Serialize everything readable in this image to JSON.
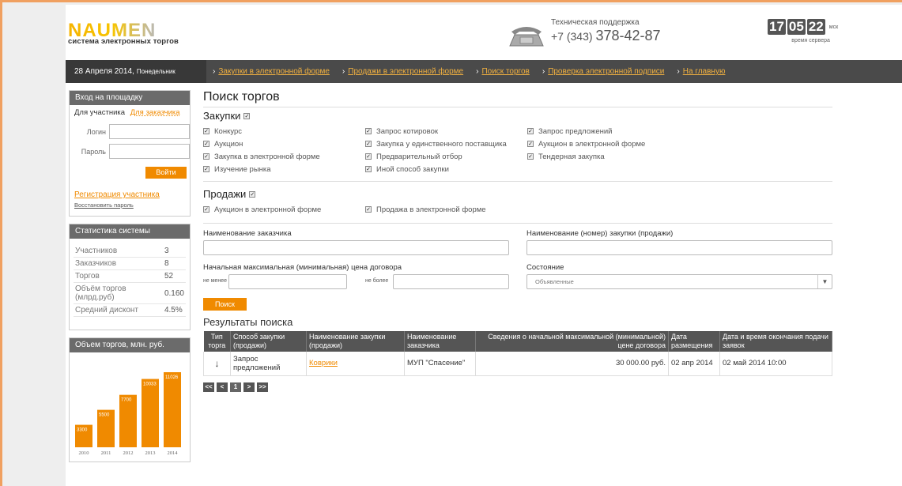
{
  "header": {
    "logo_text": "NAUMEN",
    "logo_subtitle": "система электронных торгов",
    "support_label": "Техническая поддержка",
    "support_phone_prefix": "+7 (343)",
    "support_phone_number": "378-42-87",
    "clock_hours": "17",
    "clock_minutes": "05",
    "clock_seconds": "22",
    "clock_tz": "мск",
    "clock_label": "время сервера",
    "phone_icon": "telephone-icon"
  },
  "nav": {
    "date": "28 Апреля 2014,",
    "weekday": "Понедельник",
    "links": [
      "Закупки в электронной форме",
      "Продажи в электронной форме",
      "Поиск торгов",
      "Проверка электронной подписи",
      "На главную"
    ]
  },
  "login": {
    "title": "Вход на площадку",
    "tab_active": "Для участника",
    "tab_other": "Для заказчика",
    "login_label": "Логин",
    "password_label": "Пароль",
    "login_value": "",
    "password_value": "",
    "submit": "Войти",
    "register_link": "Регистрация участника",
    "restore_link": "Восстановить пароль"
  },
  "stats": {
    "title": "Статистика системы",
    "rows": [
      {
        "label": "Участников",
        "value": "3"
      },
      {
        "label": "Заказчиков",
        "value": "8"
      },
      {
        "label": "Торгов",
        "value": "52"
      },
      {
        "label": "Объём торгов (млрд.руб)",
        "value": "0.160"
      },
      {
        "label": "Средний дисконт",
        "value": "4.5%"
      }
    ]
  },
  "volume": {
    "title": "Объем торгов, млн. руб."
  },
  "chart_data": {
    "type": "bar",
    "title": "Объем торгов, млн. руб.",
    "categories": [
      "2010",
      "2011",
      "2012",
      "2013",
      "2014"
    ],
    "values": [
      3300,
      5500,
      7700,
      10033,
      11026
    ],
    "color": "#f08a00"
  },
  "main": {
    "title": "Поиск торгов",
    "purchases_heading": "Закупки",
    "purchases": [
      "Конкурс",
      "Запрос котировок",
      "Запрос предложений",
      "Аукцион",
      "Закупка у единственного поставщика",
      "Аукцион в электронной форме",
      "Закупка в электронной форме",
      "Предварительный отбор",
      "Тендерная закупка",
      "Изучение рынка",
      "Иной способ закупки"
    ],
    "sales_heading": "Продажи",
    "sales": [
      "Аукцион в электронной форме",
      "Продажа в электронной форме"
    ],
    "customer_name_label": "Наименование заказчика",
    "customer_name_value": "",
    "purchase_name_label": "Наименование (номер) закупки (продажи)",
    "purchase_name_value": "",
    "price_label": "Начальная максимальная (минимальная) цена договора",
    "price_min_label": "не менее",
    "price_min_value": "",
    "price_max_label": "не более",
    "price_max_value": "",
    "state_label": "Состояние",
    "state_value": "Объявленные",
    "search_button": "Поиск",
    "results_title": "Результаты поиска",
    "columns": [
      "Тип торга",
      "Способ закупки (продажи)",
      "Наименование закупки (продажи)",
      "Наименование заказчика",
      "Сведения о начальной максимальной (минимальной) цене договора",
      "Дата размещения",
      "Дата и время окончания подачи заявок"
    ],
    "rows": [
      {
        "type_icon": "↓",
        "method": "Запрос предложений",
        "name": "Коврики",
        "customer": "МУП \"Спасение\"",
        "price": "30 000.00 руб.",
        "date_posted": "02 апр 2014",
        "deadline": "02 май 2014 10:00"
      }
    ],
    "pager": [
      "<<",
      "<",
      "1",
      ">",
      ">>"
    ]
  }
}
